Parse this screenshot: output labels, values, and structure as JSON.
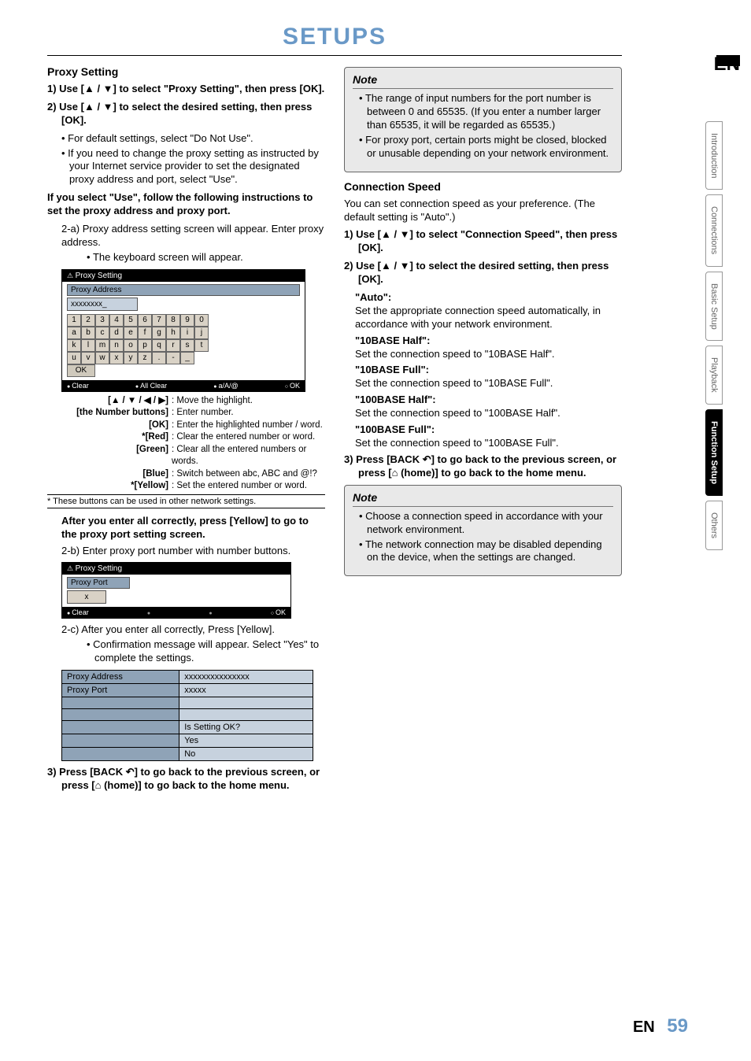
{
  "chapter": "SETUPS",
  "lang_indicator": "EN",
  "page_footer": {
    "lang": "EN",
    "num": "59"
  },
  "tabs": [
    "Introduction",
    "Connections",
    "Basic Setup",
    "Playback",
    "Function Setup",
    "Others"
  ],
  "active_tab": "Function Setup",
  "left": {
    "proxy_heading": "Proxy Setting",
    "step1": "1)  Use [▲ / ▼] to select \"Proxy Setting\", then press [OK].",
    "step2": "2)  Use [▲ / ▼] to select the desired setting, then press [OK].",
    "bul1": "For default settings, select \"Do Not Use\".",
    "bul2": "If you need to change the proxy setting as instructed by your Internet service provider to set the designated proxy address and port, select \"Use\".",
    "use_instr": "If you select \"Use\", follow the following instructions to set the proxy address and proxy port.",
    "s2a": "2-a) Proxy address setting screen will appear. Enter proxy address.",
    "s2a_b": "The keyboard screen will appear.",
    "kb": {
      "title": "Proxy Setting",
      "field": "Proxy Address",
      "value": "xxxxxxxx_",
      "keys": [
        "1",
        "2",
        "3",
        "4",
        "5",
        "6",
        "7",
        "8",
        "9",
        "0",
        "a",
        "b",
        "c",
        "d",
        "e",
        "f",
        "g",
        "h",
        "i",
        "j",
        "k",
        "l",
        "m",
        "n",
        "o",
        "p",
        "q",
        "r",
        "s",
        "t",
        "u",
        "v",
        "w",
        "x",
        "y",
        "z",
        ".",
        "-",
        "_"
      ],
      "ok": "OK",
      "foot": {
        "clear": "Clear",
        "allclear": "All Clear",
        "mode": "a/A/@",
        "ok": "OK"
      }
    },
    "legend": [
      {
        "k": "[▲ / ▼ / ◀ / ▶]",
        "v": ": Move the highlight."
      },
      {
        "k": "[the Number buttons]",
        "v": ": Enter number."
      },
      {
        "k": "[OK]",
        "v": ": Enter the highlighted number / word."
      },
      {
        "k": "*[Red]",
        "v": ": Clear the entered number or word."
      },
      {
        "k": "[Green]",
        "v": ": Clear all the entered numbers or words."
      },
      {
        "k": "[Blue]",
        "v": ": Switch between abc, ABC and @!?"
      },
      {
        "k": "*[Yellow]",
        "v": ": Set the entered number or word."
      }
    ],
    "legend_foot": "* These buttons can be used in other network settings.",
    "after": "After you enter all correctly, press [Yellow] to go to the proxy port setting screen.",
    "s2b": "2-b) Enter proxy port number with number buttons.",
    "port": {
      "title": "Proxy Setting",
      "field": "Proxy Port",
      "value": "x",
      "foot": {
        "clear": "Clear",
        "ok": "OK"
      }
    },
    "s2c": "2-c) After you enter all correctly, Press [Yellow].",
    "s2c_b": "Confirmation message will appear. Select \"Yes\" to complete the settings.",
    "tbl": {
      "r1k": "Proxy Address",
      "r1v": "xxxxxxxxxxxxxxx",
      "r2k": "Proxy Port",
      "r2v": "xxxxx",
      "q": "Is Setting OK?",
      "yes": "Yes",
      "no": "No"
    },
    "step3": "3)  Press [BACK ↶] to go back to the previous screen, or press [⌂ (home)] to go back to the home menu."
  },
  "right": {
    "note1_title": "Note",
    "note1_a": "The range of input numbers for the port number is between 0 and 65535.  (If you enter a number larger than 65535, it will be regarded as 65535.)",
    "note1_b": "For proxy port, certain ports might be closed, blocked or unusable depending on  your network environment.",
    "conn_heading": "Connection Speed",
    "conn_intro": "You can set connection speed as your preference. (The default setting is \"Auto\".)",
    "cstep1": "1)  Use [▲ / ▼] to select \"Connection Speed\", then press [OK].",
    "cstep2": "2)  Use [▲ / ▼] to select the desired setting, then press [OK].",
    "opts": [
      {
        "t": "\"Auto\":",
        "d": "Set the appropriate connection speed automatically, in accordance with your network environment."
      },
      {
        "t": "\"10BASE Half\":",
        "d": "Set the connection speed to \"10BASE Half\"."
      },
      {
        "t": "\"10BASE Full\":",
        "d": "Set the connection speed to \"10BASE Full\"."
      },
      {
        "t": "\"100BASE Half\":",
        "d": "Set the connection speed to \"100BASE Half\"."
      },
      {
        "t": "\"100BASE Full\":",
        "d": "Set the connection speed to \"100BASE Full\"."
      }
    ],
    "cstep3": "3)  Press [BACK ↶] to go back to the previous screen, or press [⌂ (home)] to go back to the home menu.",
    "note2_title": "Note",
    "note2_a": "Choose a connection speed in accordance with your network environment.",
    "note2_b": "The network connection may be disabled depending on the device, when the settings are changed."
  }
}
